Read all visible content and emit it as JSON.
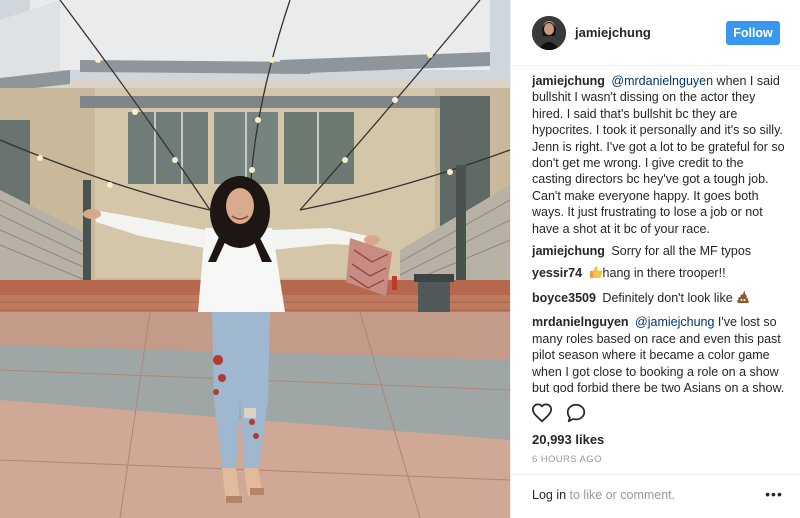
{
  "post": {
    "username": "jamiejchung",
    "follow_label": "Follow",
    "likes": "20,993 likes",
    "timestamp": "6 HOURS AGO"
  },
  "comments": [
    {
      "user": "jamiejchung",
      "mention": "@mrdanielnguyen",
      "text": " when I said bullshit I wasn't dissing on the actor they hired. I said that's bullshit bc they are hypocrites. I took it personally and it's so silly. Jenn is right. I've got a lot to be grateful for so don't get me wrong. I give credit to the casting directors bc hey've got a tough job. Can't make everyone happy. It goes both ways. It just frustrating to lose a job or not have a shot at it bc of your race."
    },
    {
      "user": "jamiejchung",
      "text": "Sorry for all the MF typos"
    },
    {
      "user": "yessir74",
      "emoji": "thumbs-up",
      "text": "hang in there trooper!!"
    },
    {
      "user": "boyce3509",
      "text": "Definitely don't look like",
      "emoji": "pile-of-poo"
    },
    {
      "user": "mrdanielnguyen",
      "mention": "@jamiejchung",
      "text": " I've lost so many roles based on race and even this past pilot season where it became a color game when I got close to booking a role on a show but god forbid there be two Asians on a show. Casting directors don't tend"
    }
  ],
  "footer": {
    "login_link": "Log in",
    "login_rest": " to like or comment.",
    "more_label": "•••"
  },
  "colors": {
    "follow_button": "#3897f0",
    "mention": "#003569",
    "muted": "#999999"
  },
  "icons": {
    "like": "heart-icon",
    "comment": "comment-bubble-icon",
    "more": "more-options-icon"
  }
}
